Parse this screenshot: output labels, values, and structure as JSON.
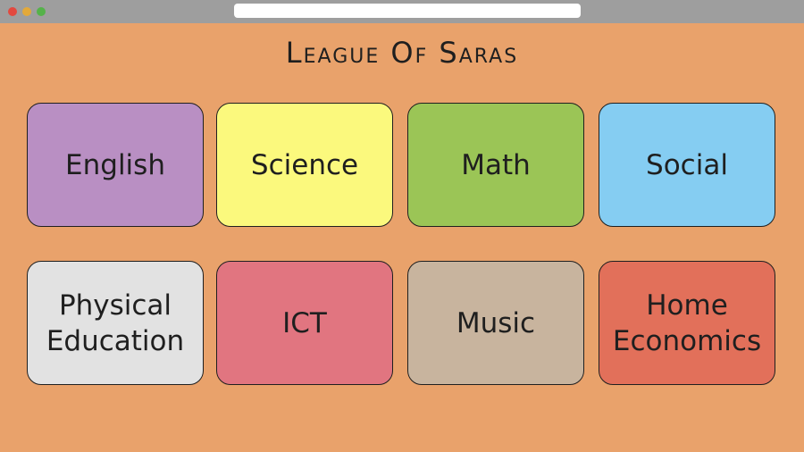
{
  "page": {
    "title": "League Of Saras",
    "background_color": "#E9A26B"
  },
  "subjects": [
    {
      "label": "English",
      "color": "#B98FC3"
    },
    {
      "label": "Science",
      "color": "#FBF97D"
    },
    {
      "label": "Math",
      "color": "#9BC556"
    },
    {
      "label": "Social",
      "color": "#85CDF2"
    },
    {
      "label": "Physical\nEducation",
      "color": "#E2E2E2"
    },
    {
      "label": "ICT",
      "color": "#E17580"
    },
    {
      "label": "Music",
      "color": "#C8B49E"
    },
    {
      "label": "Home\nEconomics",
      "color": "#E2705A"
    }
  ]
}
